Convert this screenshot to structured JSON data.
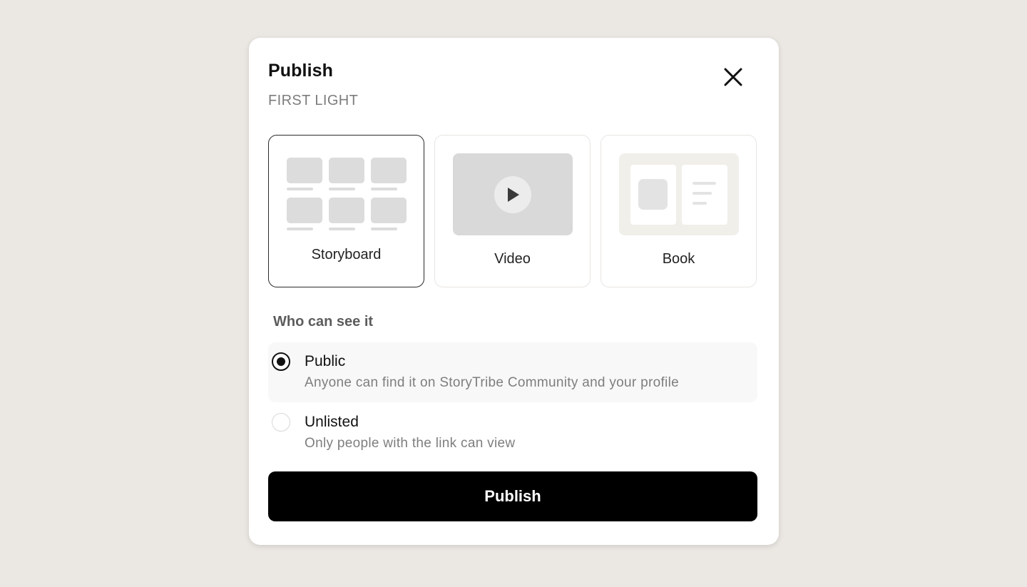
{
  "dialog": {
    "title": "Publish",
    "subtitle": "FIRST LIGHT",
    "close_icon": "close-icon"
  },
  "formats": [
    {
      "label": "Storyboard",
      "icon": "storyboard-grid-icon",
      "selected": true
    },
    {
      "label": "Video",
      "icon": "play-icon",
      "selected": false
    },
    {
      "label": "Book",
      "icon": "book-icon",
      "selected": false
    }
  ],
  "visibility": {
    "heading": "Who can see it",
    "options": [
      {
        "label": "Public",
        "description": "Anyone can find it on StoryTribe Community and your profile",
        "checked": true
      },
      {
        "label": "Unlisted",
        "description": "Only people with the link can view",
        "checked": false
      }
    ]
  },
  "actions": {
    "publish_label": "Publish"
  },
  "colors": {
    "background": "#ebe7e3",
    "primary_button": "#000000",
    "selected_border": "#2a2a2a"
  }
}
